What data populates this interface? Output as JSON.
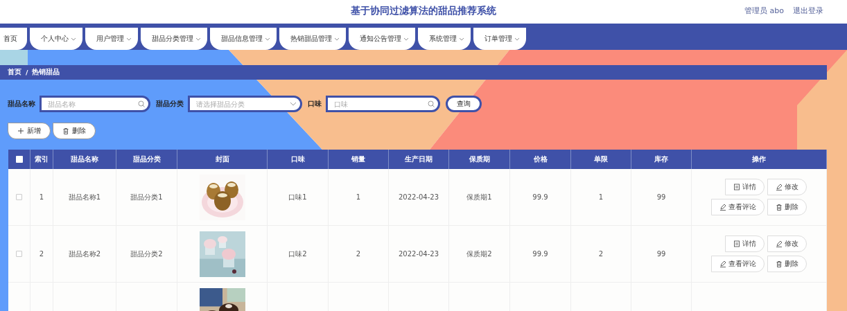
{
  "header": {
    "title": "基于协同过滤算法的甜品推荐系统",
    "user": "管理员 abo",
    "logout": "退出登录"
  },
  "nav": [
    {
      "label": "首页",
      "has_menu": false
    },
    {
      "label": "个人中心",
      "has_menu": true
    },
    {
      "label": "用户管理",
      "has_menu": true
    },
    {
      "label": "甜品分类管理",
      "has_menu": true
    },
    {
      "label": "甜品信息管理",
      "has_menu": true
    },
    {
      "label": "热销甜品管理",
      "has_menu": true
    },
    {
      "label": "通知公告管理",
      "has_menu": true
    },
    {
      "label": "系统管理",
      "has_menu": true
    },
    {
      "label": "订单管理",
      "has_menu": true
    }
  ],
  "breadcrumb": {
    "items": [
      "首页",
      "热销甜品"
    ],
    "separator": "/"
  },
  "search": {
    "fields": [
      {
        "label": "甜品名称",
        "placeholder": "甜品名称",
        "kind": "text"
      },
      {
        "label": "甜品分类",
        "placeholder": "请选择甜品分类",
        "kind": "select"
      },
      {
        "label": "口味",
        "placeholder": "口味",
        "kind": "text"
      }
    ],
    "button": "查询"
  },
  "actions": [
    {
      "label": "新增",
      "kind": "add"
    },
    {
      "label": "删除",
      "kind": "delete"
    }
  ],
  "table": {
    "select_all_checked": false,
    "columns": [
      "索引",
      "甜品名称",
      "甜品分类",
      "封面",
      "口味",
      "销量",
      "生产日期",
      "保质期",
      "价格",
      "单限",
      "库存",
      "操作"
    ],
    "rows": [
      {
        "checked": false,
        "cells": [
          "1",
          "甜品名称1",
          "甜品分类1",
          {
            "kind": "picture"
          },
          "口味1",
          "1",
          "2022-04-23",
          "保质期1",
          "99.9",
          "1",
          "99"
        ],
        "buttons": [
          {
            "label": "详情",
            "kind": "detail"
          },
          {
            "label": "修改",
            "kind": "edit"
          },
          {
            "label": "查看评论",
            "kind": "comment"
          },
          {
            "label": "删除",
            "kind": "delete"
          }
        ]
      },
      {
        "checked": false,
        "cells": [
          "2",
          "甜品名称2",
          "甜品分类2",
          {
            "kind": "picture"
          },
          "口味2",
          "2",
          "2022-04-23",
          "保质期2",
          "99.9",
          "2",
          "99"
        ],
        "buttons": [
          {
            "label": "详情",
            "kind": "detail"
          },
          {
            "label": "修改",
            "kind": "edit"
          },
          {
            "label": "查看评论",
            "kind": "comment"
          },
          {
            "label": "删除",
            "kind": "delete"
          }
        ]
      },
      {
        "cells": [
          "",
          "",
          "",
          {
            "kind": "picture"
          }
        ]
      }
    ]
  }
}
